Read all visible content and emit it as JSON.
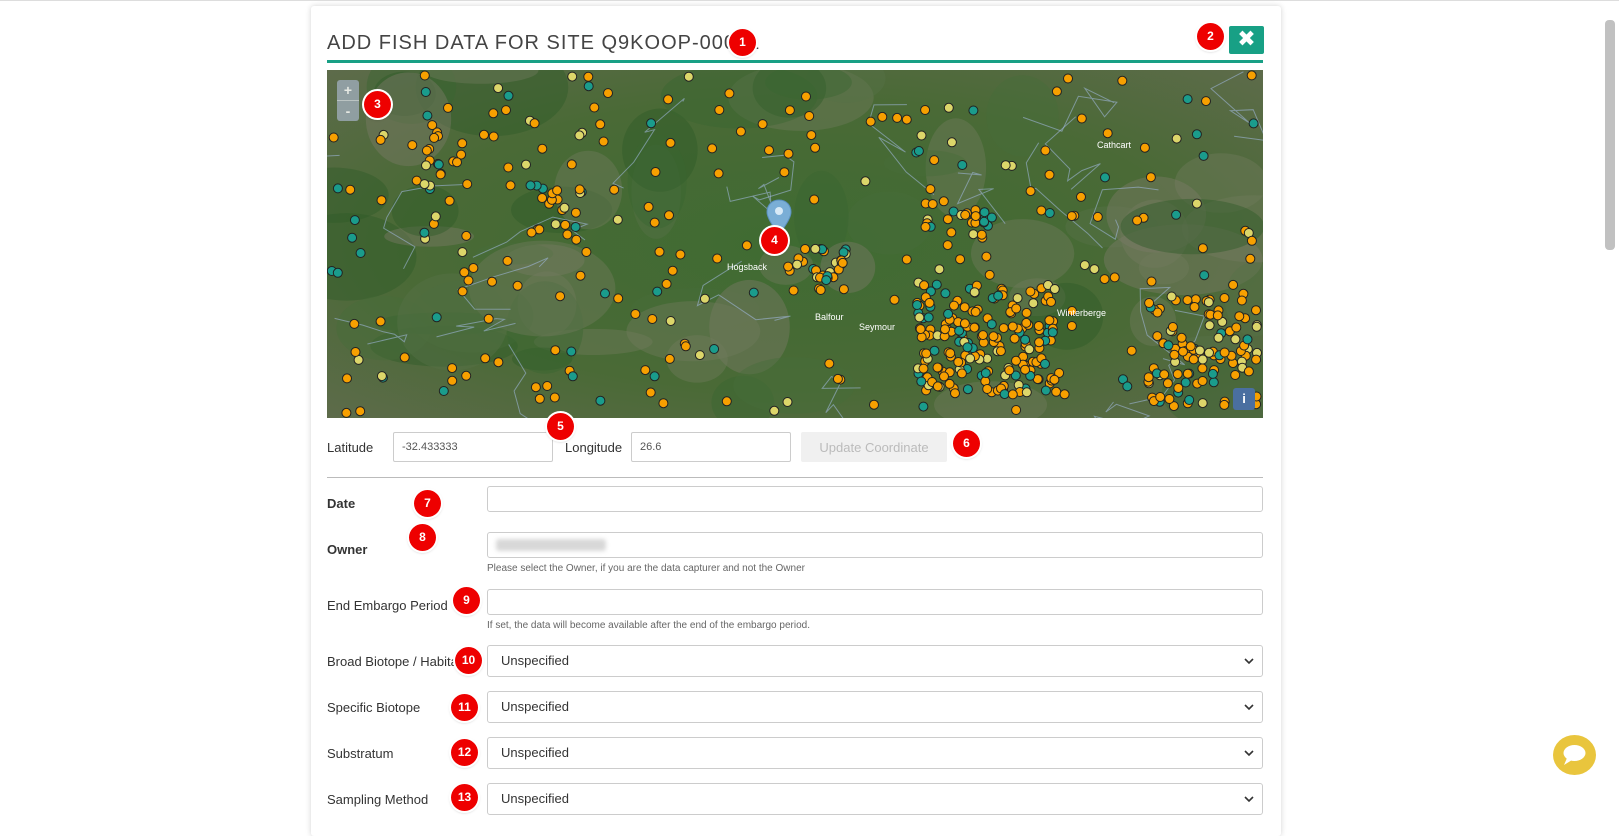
{
  "dialog": {
    "title": "ADD FISH DATA FOR SITE Q9KOOP-00001",
    "close_icon": "times-icon"
  },
  "map": {
    "zoom_in": "+",
    "zoom_out": "-",
    "info": "i",
    "place_labels": [
      "Cathcart",
      "Seymour",
      "Balfour",
      "Hogsback",
      "Winterberge"
    ]
  },
  "coordinates": {
    "latitude_label": "Latitude",
    "latitude_value": "-32.433333",
    "longitude_label": "Longitude",
    "longitude_value": "26.6",
    "update_button": "Update Coordinate"
  },
  "form": {
    "date_label": "Date",
    "date_value": "",
    "owner_label": "Owner",
    "owner_help": "Please select the Owner, if you are the data capturer and not the Owner",
    "embargo_label": "End Embargo Period",
    "embargo_help": "If set, the data will become available after the end of the embargo period.",
    "broad_biotope_label": "Broad Biotope / Habitat",
    "broad_biotope_value": "Unspecified",
    "specific_biotope_label": "Specific Biotope",
    "specific_biotope_value": "Unspecified",
    "substratum_label": "Substratum",
    "substratum_value": "Unspecified",
    "sampling_method_label": "Sampling Method",
    "sampling_method_value": "Unspecified"
  },
  "annotations": [
    "1",
    "2",
    "3",
    "4",
    "5",
    "6",
    "7",
    "8",
    "9",
    "10",
    "11",
    "12",
    "13"
  ],
  "colors": {
    "accent": "#18a085",
    "badge": "#ee0000",
    "marker_orange": "#f7a000",
    "marker_teal": "#1a9c8c",
    "marker_yellow": "#dcd66a",
    "chat": "#e9c53d"
  }
}
